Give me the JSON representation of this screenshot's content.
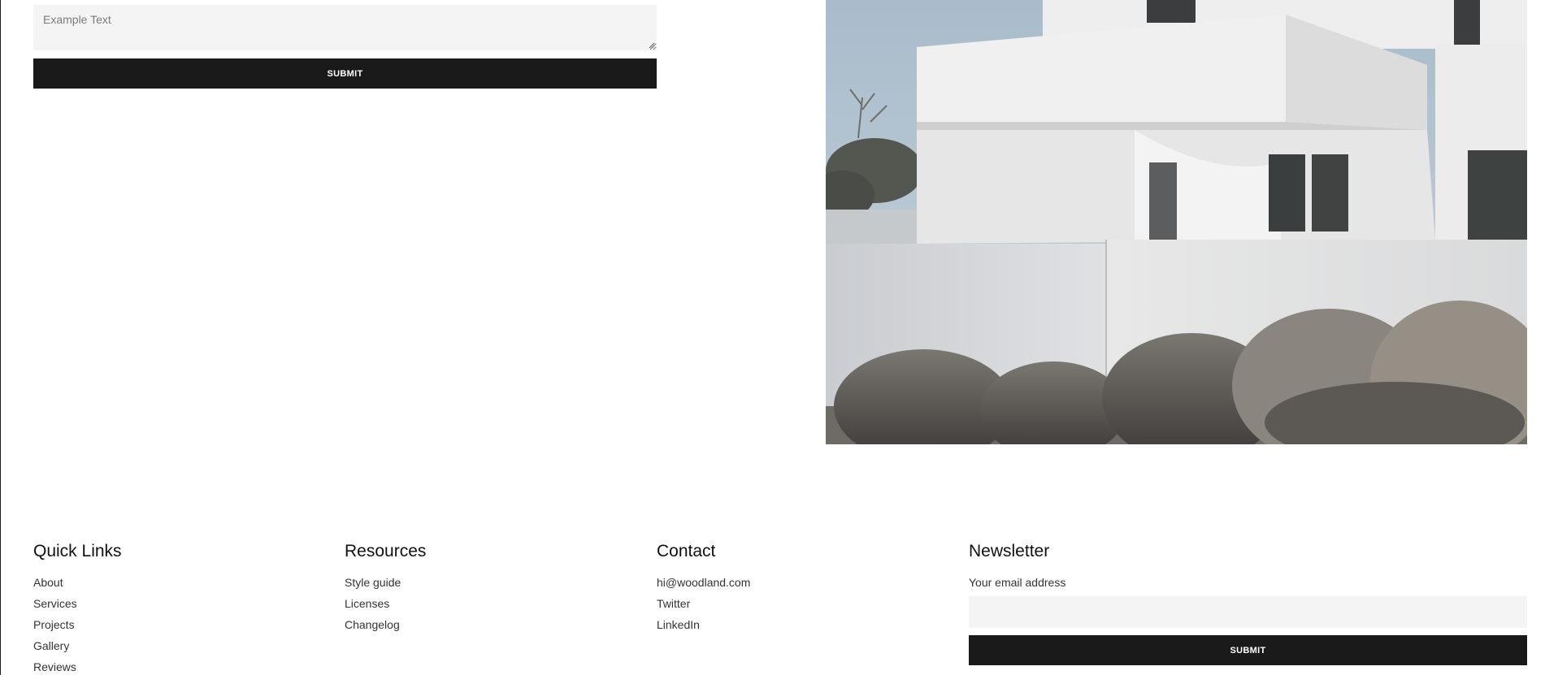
{
  "contact_form": {
    "message_placeholder": "Example Text",
    "submit_label": "SUBMIT"
  },
  "hero": {
    "image_name": "white-modern-house-photo"
  },
  "footer": {
    "quick_links": {
      "heading": "Quick Links",
      "items": [
        "About",
        "Services",
        "Projects",
        "Gallery",
        "Reviews"
      ]
    },
    "resources": {
      "heading": "Resources",
      "items": [
        "Style guide",
        "Licenses",
        "Changelog"
      ]
    },
    "contact": {
      "heading": "Contact",
      "items": [
        "hi@woodland.com",
        "Twitter",
        "LinkedIn"
      ]
    },
    "newsletter": {
      "heading": "Newsletter",
      "email_label": "Your email address",
      "email_value": "",
      "submit_label": "SUBMIT"
    }
  },
  "colors": {
    "button_bg": "#1a1a1a",
    "field_bg": "#f4f4f4",
    "text": "#111111"
  }
}
